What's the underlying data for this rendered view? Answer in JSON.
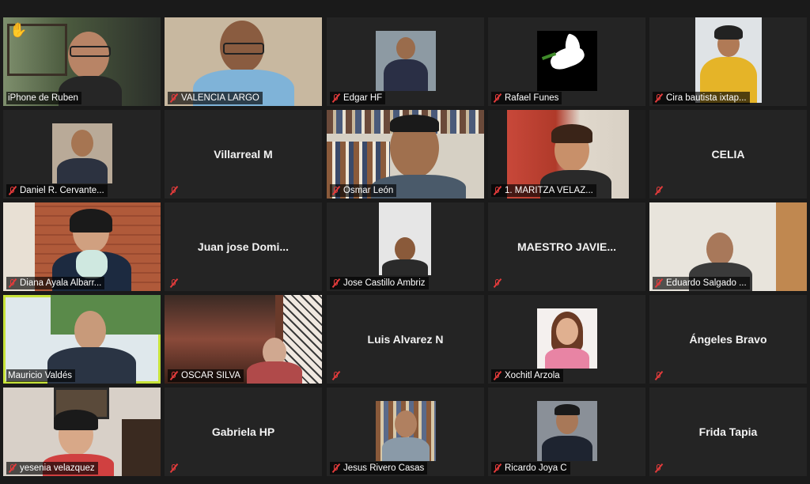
{
  "participants": [
    {
      "name": "iPhone de Ruben",
      "muted": false,
      "hand_raised": true
    },
    {
      "name": "VALENCIA LARGO",
      "muted": true
    },
    {
      "name": "Edgar HF",
      "muted": true
    },
    {
      "name": "Rafael Funes",
      "muted": true
    },
    {
      "name": "Cira bautista ixtap...",
      "muted": true
    },
    {
      "name": "Daniel R. Cervante...",
      "muted": true
    },
    {
      "name": "Villarreal M",
      "muted": true
    },
    {
      "name": "Osmar León",
      "muted": true
    },
    {
      "name": "1. MARITZA VELÁZ...",
      "muted": true
    },
    {
      "name": "CELIA",
      "muted": true
    },
    {
      "name": "Diana Ayala Albarr...",
      "muted": true
    },
    {
      "name": "Juan jose Domi...",
      "muted": true
    },
    {
      "name": "Jose Castillo Ambriz",
      "muted": true
    },
    {
      "name": "MAESTRO JAVIE...",
      "muted": true
    },
    {
      "name": "Eduardo Salgado ...",
      "muted": true
    },
    {
      "name": "Mauricio Valdés",
      "muted": false,
      "active_speaker": true
    },
    {
      "name": "OSCAR SILVA",
      "muted": true
    },
    {
      "name": "Luis Alvarez N",
      "muted": true
    },
    {
      "name": "Xochitl Arzola",
      "muted": true
    },
    {
      "name": "Ángeles Bravo",
      "muted": true
    },
    {
      "name": "yesenia velazquez",
      "muted": true
    },
    {
      "name": "Gabriela HP",
      "muted": true
    },
    {
      "name": "Jesus Rivero Casas",
      "muted": true
    },
    {
      "name": "Ricardo Joya C",
      "muted": true
    },
    {
      "name": "Frida Tapia",
      "muted": true
    }
  ],
  "icons": {
    "raised_hand": "✋",
    "mic_muted": "mic-muted-icon"
  },
  "colors": {
    "active_border": "#c8e33a",
    "muted_icon": "#e23b3b",
    "tile_bg": "#242424"
  }
}
